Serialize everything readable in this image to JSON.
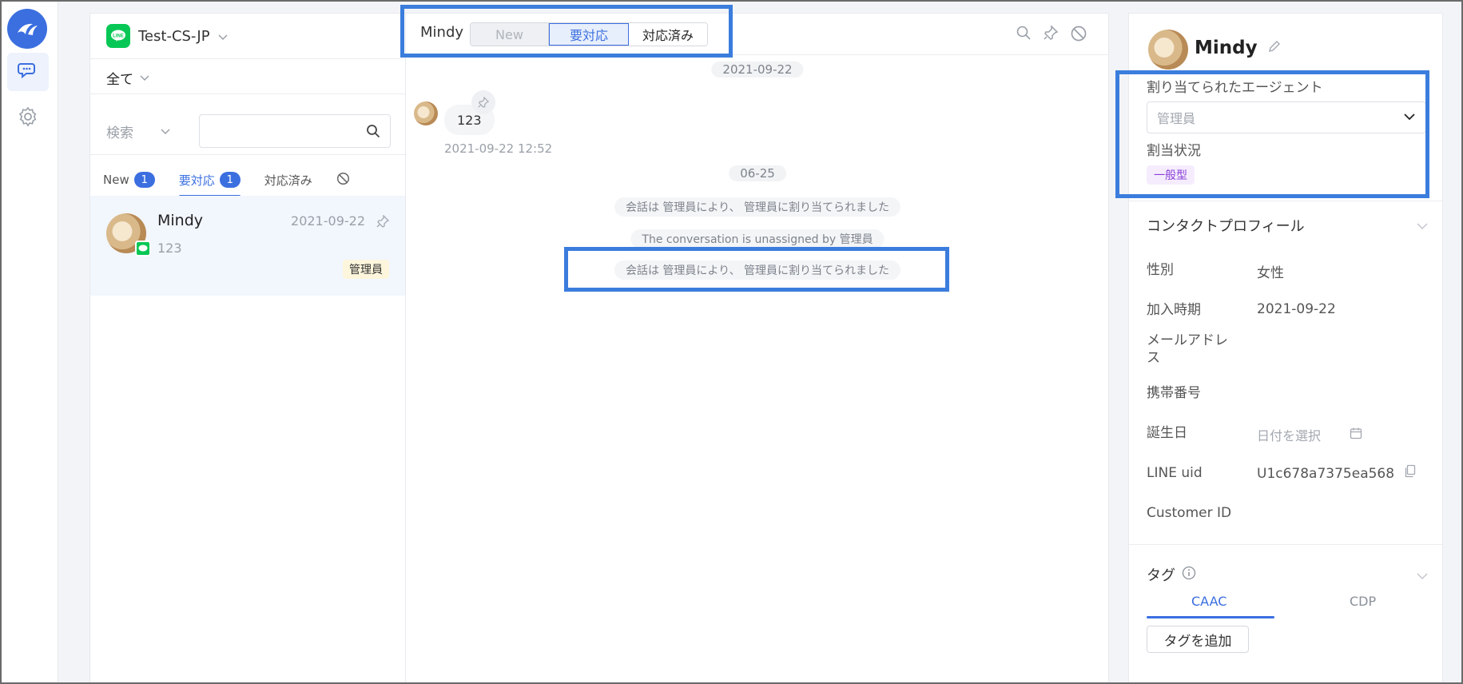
{
  "rail": {
    "items": [
      {
        "name": "chat",
        "icon": "chat-bubbles-icon",
        "active": true
      },
      {
        "name": "settings",
        "icon": "gear-icon",
        "active": false
      }
    ]
  },
  "list": {
    "channel": "Test-CS-JP",
    "filter": "全て",
    "search_type": "検索",
    "search_placeholder": "",
    "tabs": [
      {
        "label": "New",
        "count": "1"
      },
      {
        "label": "要対応",
        "count": "1",
        "active": true
      },
      {
        "label": "対応済み"
      }
    ],
    "conversations": [
      {
        "name": "Mindy",
        "date": "2021-09-22",
        "last_message": "123",
        "agent": "管理員"
      }
    ]
  },
  "chat": {
    "contact_name": "Mindy",
    "status_buttons": [
      "New",
      "要対応",
      "対応済み"
    ],
    "date_pill_1": "2021-09-22",
    "message_text": "123",
    "message_time": "2021-09-22 12:52",
    "date_pill_2": "06-25",
    "system_messages": [
      "会話は 管理員により、 管理員に割り当てられました",
      "The conversation is unassigned by 管理員",
      "会話は 管理員により、 管理員に割り当てられました"
    ]
  },
  "info": {
    "name": "Mindy",
    "assigned_agent_label": "割り当てられたエージェント",
    "assigned_agent_value": "管理員",
    "assign_status_label": "割当状況",
    "assign_status_value": "一般型",
    "profile_title": "コンタクトプロフィール",
    "fields": {
      "gender_label": "性別",
      "gender_value": "女性",
      "joined_label": "加入時期",
      "joined_value": "2021-09-22",
      "email_label": "メールアドレス",
      "phone_label": "携帯番号",
      "birthday_label": "誕生日",
      "birthday_placeholder": "日付を選択",
      "line_uid_label": "LINE uid",
      "line_uid_value": "U1c678a7375ea568",
      "customer_id_label": "Customer ID"
    },
    "tags_title": "タグ",
    "tag_tabs": [
      "CAAC",
      "CDP"
    ],
    "add_tag_label": "タグを追加"
  },
  "colors": {
    "accent": "#3b6fe0",
    "highlight": "#3b7ddd",
    "line_green": "#06c755",
    "assign_tag_text": "#8b3fd8"
  }
}
